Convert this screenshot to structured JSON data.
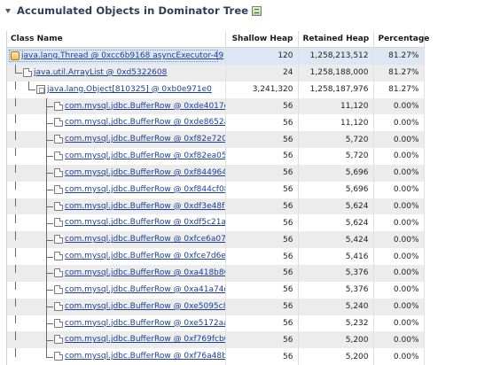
{
  "header": {
    "title": "Accumulated Objects in Dominator Tree",
    "collapse_icon": "triangle-down-icon",
    "view_icon": "table-view-icon"
  },
  "columns": {
    "name": "Class Name",
    "shallow": "Shallow Heap",
    "retained": "Retained Heap",
    "percentage": "Percentage"
  },
  "rows": [
    {
      "depth": 0,
      "icon": "thread-icon",
      "name": "java.lang.Thread @ 0xcc6b9168  asyncExecutor-49",
      "shallow": "120",
      "retained": "1,258,213,512",
      "percentage": "81.27%"
    },
    {
      "depth": 1,
      "icon": "object-icon",
      "name": "java.util.ArrayList @ 0xd5322608",
      "shallow": "24",
      "retained": "1,258,188,000",
      "percentage": "81.27%"
    },
    {
      "depth": 2,
      "icon": "array-icon",
      "name": "java.lang.Object[810325] @ 0xb0e971e0",
      "shallow": "3,241,320",
      "retained": "1,258,187,976",
      "percentage": "81.27%"
    },
    {
      "depth": 3,
      "icon": "object-icon",
      "name": "com.mysql.jdbc.BufferRow @ 0xde4017d8",
      "shallow": "56",
      "retained": "11,120",
      "percentage": "0.00%"
    },
    {
      "depth": 3,
      "icon": "object-icon",
      "name": "com.mysql.jdbc.BufferRow @ 0xde8652a8",
      "shallow": "56",
      "retained": "11,120",
      "percentage": "0.00%"
    },
    {
      "depth": 3,
      "icon": "object-icon",
      "name": "com.mysql.jdbc.BufferRow @ 0xf82e7200",
      "shallow": "56",
      "retained": "5,720",
      "percentage": "0.00%"
    },
    {
      "depth": 3,
      "icon": "object-icon",
      "name": "com.mysql.jdbc.BufferRow @ 0xf82ea058",
      "shallow": "56",
      "retained": "5,720",
      "percentage": "0.00%"
    },
    {
      "depth": 3,
      "icon": "object-icon",
      "name": "com.mysql.jdbc.BufferRow @ 0xf8449640",
      "shallow": "56",
      "retained": "5,696",
      "percentage": "0.00%"
    },
    {
      "depth": 3,
      "icon": "object-icon",
      "name": "com.mysql.jdbc.BufferRow @ 0xf844cf08",
      "shallow": "56",
      "retained": "5,696",
      "percentage": "0.00%"
    },
    {
      "depth": 3,
      "icon": "object-icon",
      "name": "com.mysql.jdbc.BufferRow @ 0xdf3e48f8",
      "shallow": "56",
      "retained": "5,624",
      "percentage": "0.00%"
    },
    {
      "depth": 3,
      "icon": "object-icon",
      "name": "com.mysql.jdbc.BufferRow @ 0xdf5c21a8",
      "shallow": "56",
      "retained": "5,624",
      "percentage": "0.00%"
    },
    {
      "depth": 3,
      "icon": "object-icon",
      "name": "com.mysql.jdbc.BufferRow @ 0xfce6a070",
      "shallow": "56",
      "retained": "5,424",
      "percentage": "0.00%"
    },
    {
      "depth": 3,
      "icon": "object-icon",
      "name": "com.mysql.jdbc.BufferRow @ 0xfce7d6e0",
      "shallow": "56",
      "retained": "5,416",
      "percentage": "0.00%"
    },
    {
      "depth": 3,
      "icon": "object-icon",
      "name": "com.mysql.jdbc.BufferRow @ 0xa418b860",
      "shallow": "56",
      "retained": "5,376",
      "percentage": "0.00%"
    },
    {
      "depth": 3,
      "icon": "object-icon",
      "name": "com.mysql.jdbc.BufferRow @ 0xa41a74d8",
      "shallow": "56",
      "retained": "5,376",
      "percentage": "0.00%"
    },
    {
      "depth": 3,
      "icon": "object-icon",
      "name": "com.mysql.jdbc.BufferRow @ 0xe5095c88",
      "shallow": "56",
      "retained": "5,240",
      "percentage": "0.00%"
    },
    {
      "depth": 3,
      "icon": "object-icon",
      "name": "com.mysql.jdbc.BufferRow @ 0xe5172aa8",
      "shallow": "56",
      "retained": "5,232",
      "percentage": "0.00%"
    },
    {
      "depth": 3,
      "icon": "object-icon",
      "name": "com.mysql.jdbc.BufferRow @ 0xf769fcb0",
      "shallow": "56",
      "retained": "5,200",
      "percentage": "0.00%"
    },
    {
      "depth": 3,
      "icon": "object-icon",
      "name": "com.mysql.jdbc.BufferRow @ 0xf76a48b8",
      "shallow": "56",
      "retained": "5,200",
      "percentage": "0.00%"
    }
  ]
}
